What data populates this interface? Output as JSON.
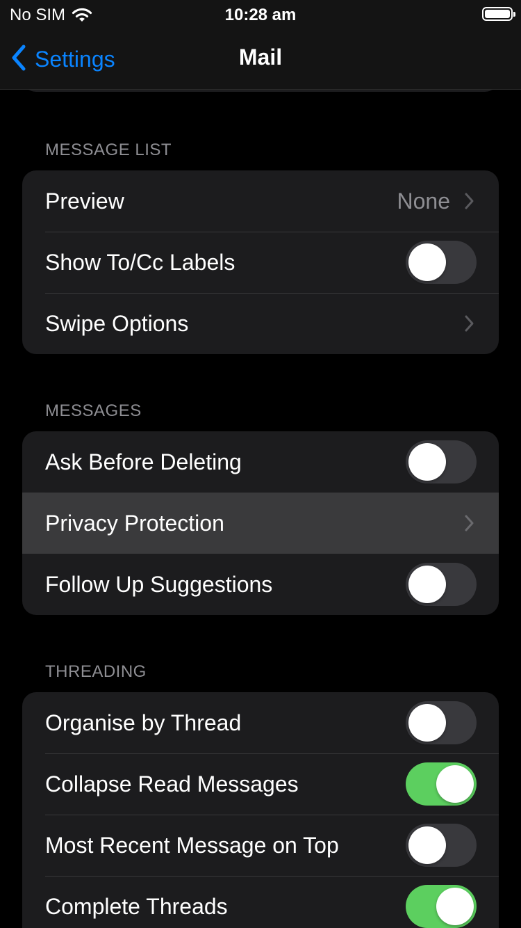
{
  "status_bar": {
    "carrier": "No SIM",
    "time": "10:28 am",
    "wifi_icon": "wifi-icon",
    "battery_icon": "battery-icon"
  },
  "nav": {
    "back_label": "Settings",
    "title": "Mail"
  },
  "colors": {
    "accent": "#0a84ff",
    "toggle_on": "#5ccf5f",
    "toggle_off": "#39393d",
    "group_bg": "#1c1c1e",
    "highlight_bg": "#3a3a3c"
  },
  "sections": {
    "message_list": {
      "header": "MESSAGE LIST",
      "rows": [
        {
          "label": "Preview",
          "value": "None",
          "type": "disclosure"
        },
        {
          "label": "Show To/Cc Labels",
          "type": "toggle",
          "on": false
        },
        {
          "label": "Swipe Options",
          "type": "disclosure"
        }
      ]
    },
    "messages": {
      "header": "MESSAGES",
      "rows": [
        {
          "label": "Ask Before Deleting",
          "type": "toggle",
          "on": false
        },
        {
          "label": "Privacy Protection",
          "type": "disclosure",
          "highlighted": true
        },
        {
          "label": "Follow Up Suggestions",
          "type": "toggle",
          "on": false
        }
      ]
    },
    "threading": {
      "header": "THREADING",
      "rows": [
        {
          "label": "Organise by Thread",
          "type": "toggle",
          "on": false
        },
        {
          "label": "Collapse Read Messages",
          "type": "toggle",
          "on": true
        },
        {
          "label": "Most Recent Message on Top",
          "type": "toggle",
          "on": false
        },
        {
          "label": "Complete Threads",
          "type": "toggle",
          "on": true
        }
      ]
    }
  }
}
